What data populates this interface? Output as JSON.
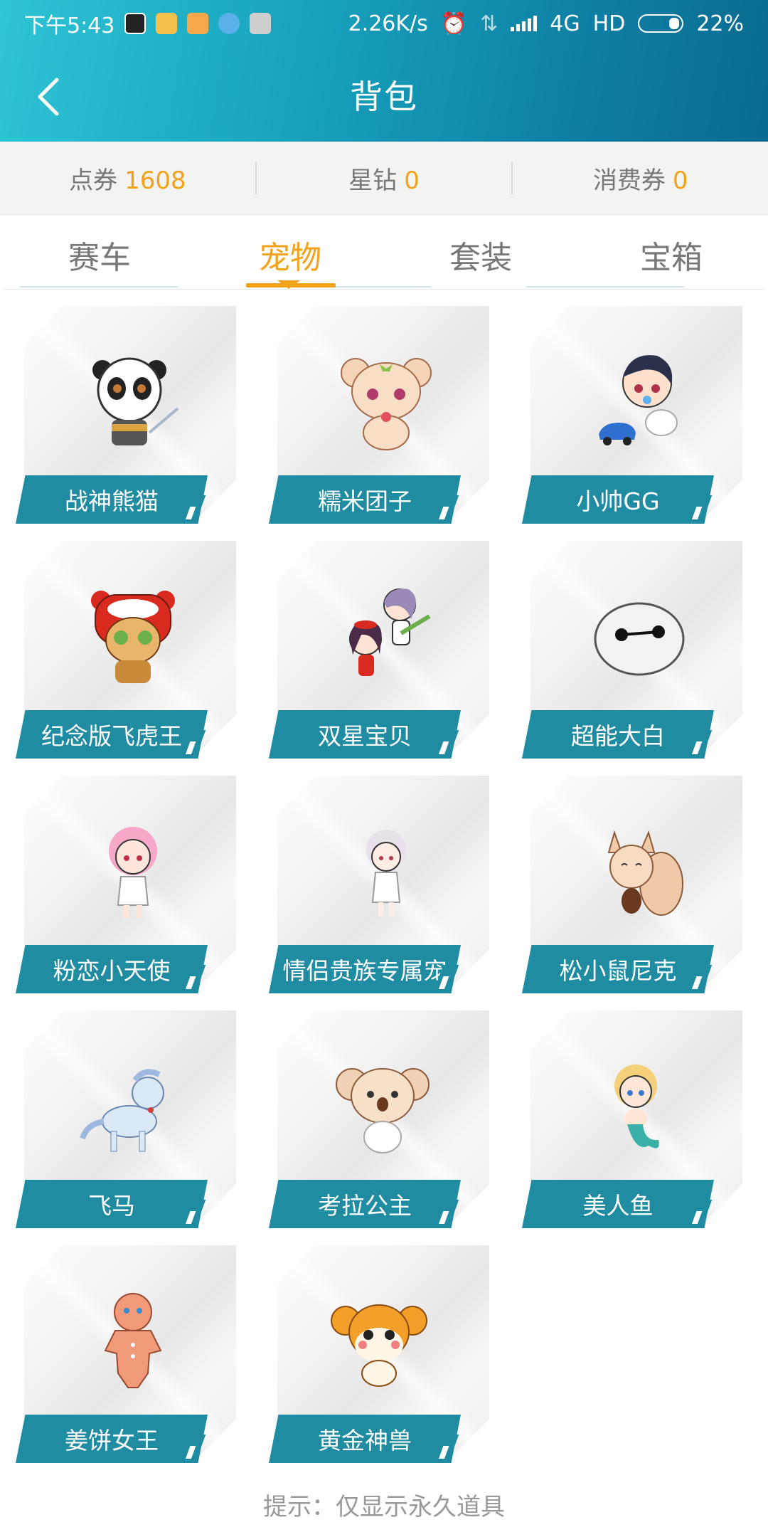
{
  "statusbar": {
    "time": "下午5:43",
    "network_speed": "2.26K/s",
    "network_type": "4G",
    "hd": "HD",
    "battery": "22%"
  },
  "header": {
    "title": "背包"
  },
  "currency": {
    "items": [
      {
        "label": "点券",
        "value": "1608"
      },
      {
        "label": "星钻",
        "value": "0"
      },
      {
        "label": "消费券",
        "value": "0"
      }
    ]
  },
  "tabs": [
    {
      "label": "赛车",
      "active": false
    },
    {
      "label": "宠物",
      "active": true
    },
    {
      "label": "套装",
      "active": false
    },
    {
      "label": "宝箱",
      "active": false
    }
  ],
  "pets": [
    {
      "name": "战神熊猫",
      "icon": "panda-warrior-icon"
    },
    {
      "name": "糯米团子",
      "icon": "rice-dumpling-bear-icon"
    },
    {
      "name": "小帅GG",
      "icon": "baby-boy-icon"
    },
    {
      "name": "纪念版飞虎王",
      "icon": "tiger-king-icon"
    },
    {
      "name": "双星宝贝",
      "icon": "twin-star-girls-icon"
    },
    {
      "name": "超能大白",
      "icon": "baymax-icon"
    },
    {
      "name": "粉恋小天使",
      "icon": "pink-angel-icon"
    },
    {
      "name": "情侣贵族专属宠",
      "icon": "noble-couple-pet-icon"
    },
    {
      "name": "松小鼠尼克",
      "icon": "squirrel-icon"
    },
    {
      "name": "飞马",
      "icon": "pegasus-icon"
    },
    {
      "name": "考拉公主",
      "icon": "koala-princess-icon"
    },
    {
      "name": "美人鱼",
      "icon": "mermaid-icon"
    },
    {
      "name": "姜饼女王",
      "icon": "gingerbread-queen-icon"
    },
    {
      "name": "黄金神兽",
      "icon": "golden-beast-icon"
    }
  ],
  "hint": "提示：仅显示永久道具",
  "colors": {
    "accent": "#f3a21b",
    "label_band": "#1f8ca2",
    "header_start": "#2fc4d6",
    "header_end": "#0a6a8f"
  }
}
